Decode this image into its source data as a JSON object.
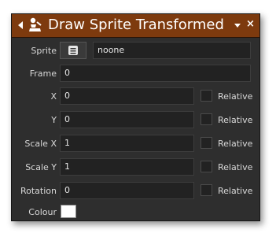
{
  "header": {
    "title": "Draw Sprite Transformed",
    "collapse_icon": "collapse-arrow-icon",
    "action_icon": "draw-sprite-icon",
    "menu_icon": "chevron-down-icon",
    "close_glyph": "×"
  },
  "fields": {
    "sprite": {
      "label": "Sprite",
      "value": "noone",
      "icon": "sprite-browse-icon"
    },
    "frame": {
      "label": "Frame",
      "value": "0"
    },
    "x": {
      "label": "X",
      "value": "0",
      "relative_label": "Relative",
      "relative_checked": false
    },
    "y": {
      "label": "Y",
      "value": "0",
      "relative_label": "Relative",
      "relative_checked": false
    },
    "scale_x": {
      "label": "Scale X",
      "value": "1",
      "relative_label": "Relative",
      "relative_checked": false
    },
    "scale_y": {
      "label": "Scale Y",
      "value": "1",
      "relative_label": "Relative",
      "relative_checked": false
    },
    "rotation": {
      "label": "Rotation",
      "value": "0",
      "relative_label": "Relative",
      "relative_checked": false
    },
    "colour": {
      "label": "Colour",
      "value": "#ffffff"
    }
  },
  "colors": {
    "header_bg": "#7d3a0e",
    "panel_bg": "#2e2e2e",
    "field_bg": "#222222"
  }
}
